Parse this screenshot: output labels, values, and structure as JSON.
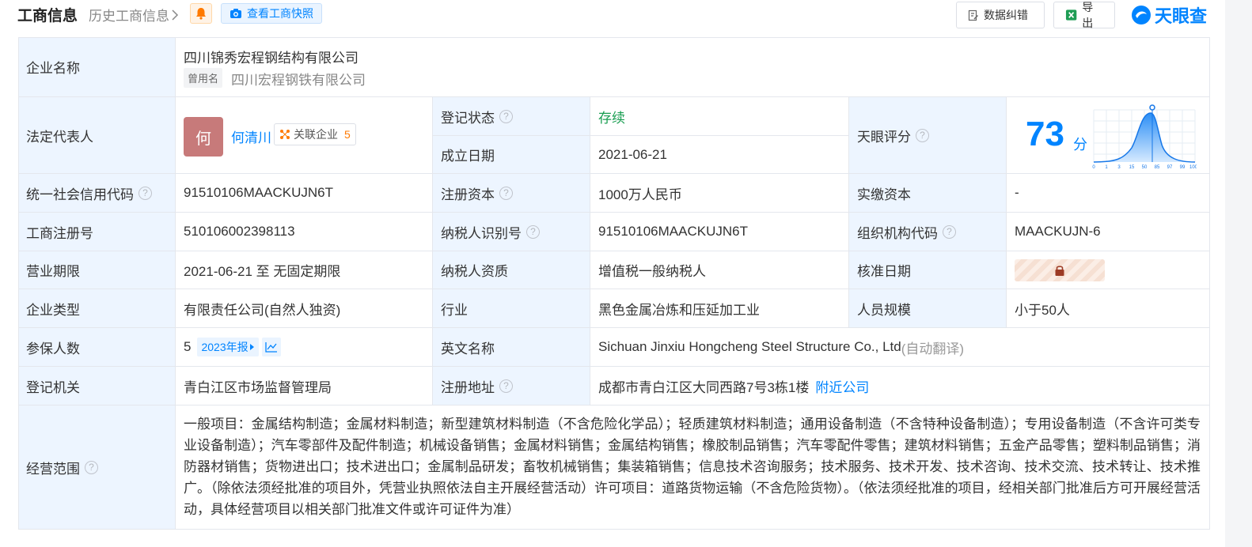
{
  "header": {
    "title": "工商信息",
    "history_link": "历史工商信息",
    "snapshot_button": "查看工商快照",
    "error_button": "数据纠错",
    "export_button": "导出",
    "brand": "天眼查"
  },
  "company": {
    "label": "企业名称",
    "name": "四川锦秀宏程钢结构有限公司",
    "former_tag": "曾用名",
    "former_name": "四川宏程钢铁有限公司"
  },
  "legal_rep": {
    "label": "法定代表人",
    "avatar_char": "何",
    "name": "何清川",
    "related_label": "关联企业",
    "related_count": "5"
  },
  "reg_status": {
    "label": "登记状态",
    "value": "存续",
    "color": "#1a9e52"
  },
  "found_date": {
    "label": "成立日期",
    "value": "2021-06-21"
  },
  "score": {
    "label": "天眼评分",
    "value": "73",
    "unit": "分",
    "axis_ticks": [
      "0",
      "1",
      "3",
      "15",
      "50",
      "85",
      "97",
      "99",
      "100"
    ]
  },
  "credit_code": {
    "label": "统一社会信用代码",
    "value": "91510106MAACKUJN6T"
  },
  "reg_capital": {
    "label": "注册资本",
    "value": "1000万人民币"
  },
  "paid_capital": {
    "label": "实缴资本",
    "value": "-"
  },
  "reg_no": {
    "label": "工商注册号",
    "value": "510106002398113"
  },
  "taxpayer_id": {
    "label": "纳税人识别号",
    "value": "91510106MAACKUJN6T"
  },
  "org_code": {
    "label": "组织机构代码",
    "value": "MAACKUJN-6"
  },
  "term": {
    "label": "营业期限",
    "value": "2021-06-21 至 无固定期限"
  },
  "taxpayer_qual": {
    "label": "纳税人资质",
    "value": "增值税一般纳税人"
  },
  "approve_date": {
    "label": "核准日期"
  },
  "company_type": {
    "label": "企业类型",
    "value": "有限责任公司(自然人独资)"
  },
  "industry": {
    "label": "行业",
    "value": "黑色金属冶炼和压延加工业"
  },
  "staff_size": {
    "label": "人员规模",
    "value": "小于50人"
  },
  "insured": {
    "label": "参保人数",
    "value": "5",
    "year_tag": "2023年报"
  },
  "english_name": {
    "label": "英文名称",
    "value": "Sichuan Jinxiu Hongcheng Steel Structure Co., Ltd",
    "note": "(自动翻译)"
  },
  "authority": {
    "label": "登记机关",
    "value": "青白江区市场监督管理局"
  },
  "address": {
    "label": "注册地址",
    "value": "成都市青白江区大同西路7号3栋1楼",
    "link": "附近公司"
  },
  "scope": {
    "label": "经营范围",
    "value": "一般项目：金属结构制造；金属材料制造；新型建筑材料制造（不含危险化学品）；轻质建筑材料制造；通用设备制造（不含特种设备制造）；专用设备制造（不含许可类专业设备制造）；汽车零部件及配件制造；机械设备销售；金属材料销售；金属结构销售；橡胶制品销售；汽车零配件零售；建筑材料销售；五金产品零售；塑料制品销售；消防器材销售；货物进出口；技术进出口；金属制品研发；畜牧机械销售；集装箱销售；信息技术咨询服务；技术服务、技术开发、技术咨询、技术交流、技术转让、技术推广。（除依法须经批准的项目外，凭营业执照依法自主开展经营活动）许可项目：道路货物运输（不含危险货物）。（依法须经批准的项目，经相关部门批准后方可开展经营活动，具体经营项目以相关部门批准文件或许可证件为准）"
  }
}
